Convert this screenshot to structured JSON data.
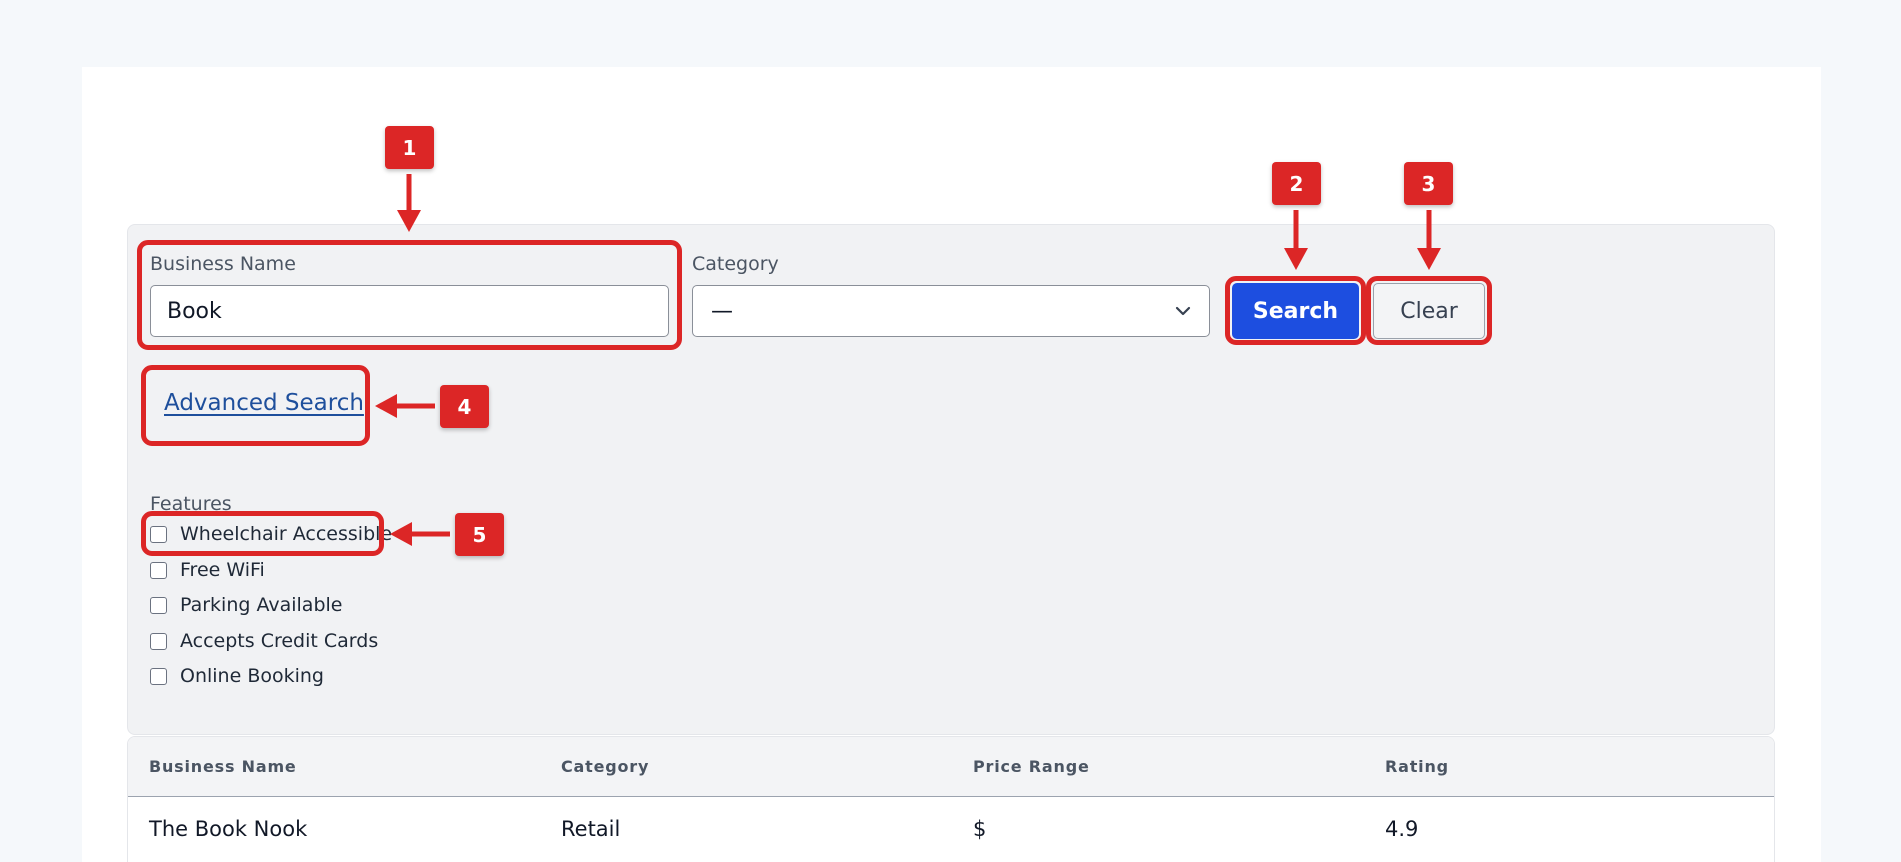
{
  "search": {
    "business_name_label": "Business Name",
    "business_name_value": "Book",
    "category_label": "Category",
    "category_value": "—",
    "search_button": "Search",
    "clear_button": "Clear",
    "advanced_link": "Advanced Search"
  },
  "features": {
    "label": "Features",
    "items": [
      "Wheelchair Accessible",
      "Free WiFi",
      "Parking Available",
      "Accepts Credit Cards",
      "Online Booking"
    ]
  },
  "table": {
    "headers": [
      "Business Name",
      "Category",
      "Price Range",
      "Rating"
    ],
    "rows": [
      [
        "The Book Nook",
        "Retail",
        "$",
        "4.9"
      ]
    ]
  },
  "annotations": [
    "1",
    "2",
    "3",
    "4",
    "5"
  ],
  "colors": {
    "annotation": "#dc2626",
    "primary_button": "#1d4ee0",
    "link": "#1e4f9c"
  }
}
